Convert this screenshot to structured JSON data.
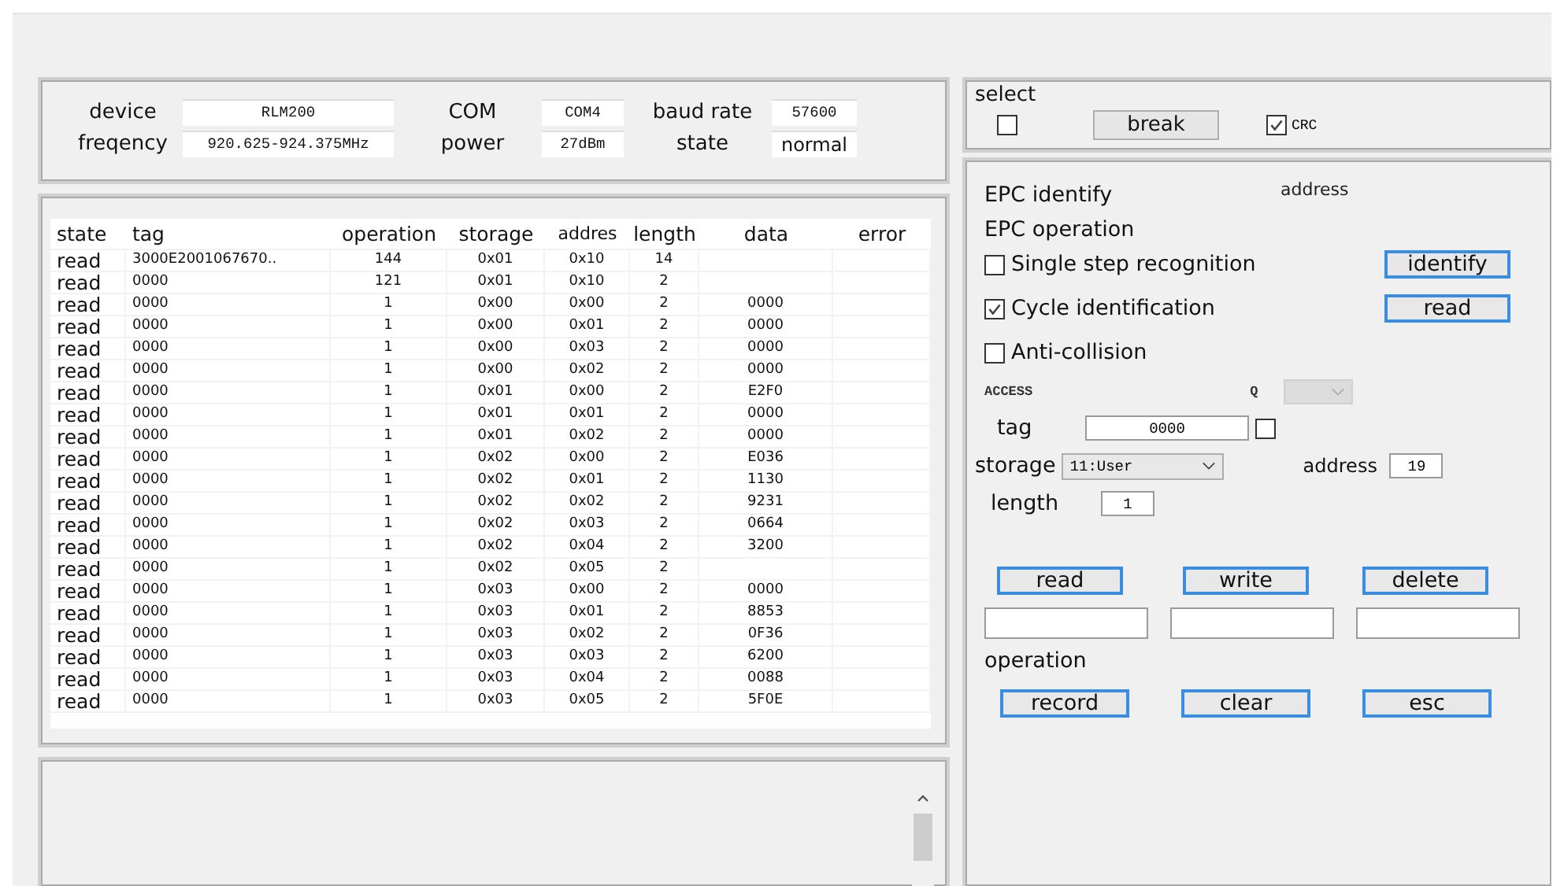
{
  "device_info": {
    "fields": [
      {
        "label": "device",
        "value": "RLM200"
      },
      {
        "label": "COM",
        "value": "COM4"
      },
      {
        "label": "baud rate",
        "value": "57600"
      },
      {
        "label": "freqency",
        "value": "920.625-924.375MHz"
      },
      {
        "label": "power",
        "value": "27dBm"
      },
      {
        "label": "state",
        "value": "normal"
      }
    ]
  },
  "table": {
    "columns": [
      "state",
      "tag",
      "operation",
      "storage",
      "addres",
      "length",
      "data",
      "error"
    ],
    "rows": [
      [
        "read",
        "3000E2001067670..",
        "144",
        "0x01",
        "0x10",
        "14",
        ""
      ],
      [
        "read",
        "0000",
        "121",
        "0x01",
        "0x10",
        "2",
        ""
      ],
      [
        "read",
        "0000",
        "1",
        "0x00",
        "0x00",
        "2",
        "0000"
      ],
      [
        "read",
        "0000",
        "1",
        "0x00",
        "0x01",
        "2",
        "0000"
      ],
      [
        "read",
        "0000",
        "1",
        "0x00",
        "0x03",
        "2",
        "0000"
      ],
      [
        "read",
        "0000",
        "1",
        "0x00",
        "0x02",
        "2",
        "0000"
      ],
      [
        "read",
        "0000",
        "1",
        "0x01",
        "0x00",
        "2",
        "E2F0"
      ],
      [
        "read",
        "0000",
        "1",
        "0x01",
        "0x01",
        "2",
        "0000"
      ],
      [
        "read",
        "0000",
        "1",
        "0x01",
        "0x02",
        "2",
        "0000"
      ],
      [
        "read",
        "0000",
        "1",
        "0x02",
        "0x00",
        "2",
        "E036"
      ],
      [
        "read",
        "0000",
        "1",
        "0x02",
        "0x01",
        "2",
        "1130"
      ],
      [
        "read",
        "0000",
        "1",
        "0x02",
        "0x02",
        "2",
        "9231"
      ],
      [
        "read",
        "0000",
        "1",
        "0x02",
        "0x03",
        "2",
        "0664"
      ],
      [
        "read",
        "0000",
        "1",
        "0x02",
        "0x04",
        "2",
        "3200"
      ],
      [
        "read",
        "0000",
        "1",
        "0x02",
        "0x05",
        "2",
        ""
      ],
      [
        "read",
        "0000",
        "1",
        "0x03",
        "0x00",
        "2",
        "0000"
      ],
      [
        "read",
        "0000",
        "1",
        "0x03",
        "0x01",
        "2",
        "8853"
      ],
      [
        "read",
        "0000",
        "1",
        "0x03",
        "0x02",
        "2",
        "0F36"
      ],
      [
        "read",
        "0000",
        "1",
        "0x03",
        "0x03",
        "2",
        "6200"
      ],
      [
        "read",
        "0000",
        "1",
        "0x03",
        "0x04",
        "2",
        "0088"
      ],
      [
        "read",
        "0000",
        "1",
        "0x03",
        "0x05",
        "2",
        "5F0E"
      ]
    ]
  },
  "select": {
    "title": "select",
    "checked": false,
    "break_button": "break",
    "crc": {
      "label": "CRC",
      "checked": true
    }
  },
  "epc": {
    "address_label": "address",
    "identify_label": "EPC identify",
    "operation_label": "EPC operation",
    "options": [
      {
        "label": "Single step recognition",
        "checked": false,
        "button": "identify"
      },
      {
        "label": "Cycle identification",
        "checked": true,
        "button": "read"
      },
      {
        "label": "Anti-collision",
        "checked": false
      }
    ]
  },
  "access": {
    "label": "ACCESS",
    "q_label": "Q",
    "q_disabled": true,
    "tag_label": "tag",
    "tag_value": "0000",
    "tag_checked": false,
    "storage_label": "storage",
    "storage_value": "11:User",
    "address_label": "address",
    "address_value": "19",
    "length_label": "length",
    "length_value": "1",
    "buttons": [
      "read",
      "write",
      "delete"
    ]
  },
  "operation": {
    "label": "operation",
    "buttons": [
      "record",
      "clear",
      "esc"
    ]
  }
}
